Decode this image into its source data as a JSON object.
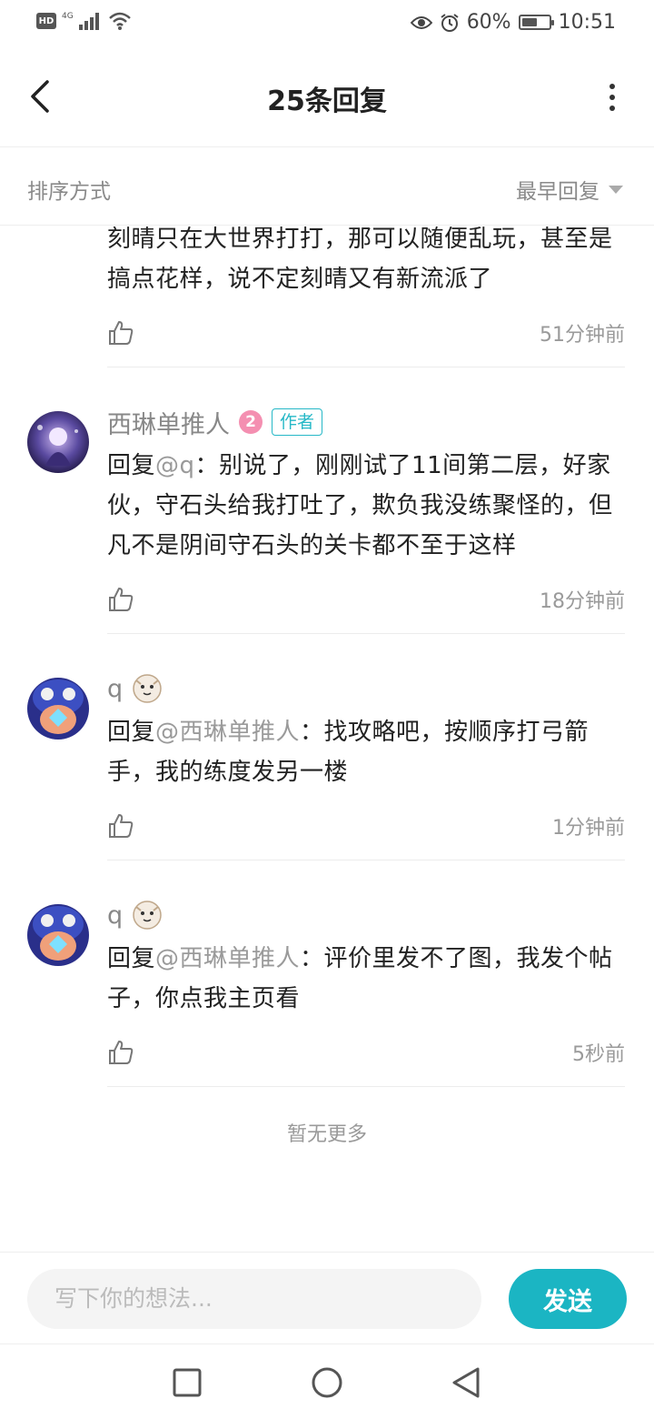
{
  "status_bar": {
    "hd": "HD",
    "network": "4G",
    "battery": "60%",
    "battery_level": 0.6,
    "time": "10:51"
  },
  "header": {
    "title": "25条回复"
  },
  "sort": {
    "label": "排序方式",
    "value": "最早回复"
  },
  "comments": [
    {
      "partial": true,
      "text": "刻晴只在大世界打打，那可以随便乱玩，甚至是搞点花样，说不定刻晴又有新流派了",
      "time": "51分钟前"
    },
    {
      "user": "西琳单推人",
      "level": "2",
      "tag": "作者",
      "reply_prefix": "回复",
      "mention": "@q",
      "text": "：别说了，刚刚试了11间第二层，好家伙，守石头给我打吐了，欺负我没练聚怪的，但凡不是阴间守石头的关卡都不至于这样",
      "time": "18分钟前"
    },
    {
      "user": "q",
      "reply_prefix": "回复",
      "mention": "@西琳单推人",
      "text": "：找攻略吧，按顺序打弓箭手，我的练度发另一楼",
      "time": "1分钟前"
    },
    {
      "user": "q",
      "reply_prefix": "回复",
      "mention": "@西琳单推人",
      "text": "：评价里发不了图，我发个帖子，你点我主页看",
      "time": "5秒前"
    }
  ],
  "footer_note": "暂无更多",
  "input": {
    "placeholder": "写下你的想法..."
  },
  "send_label": "发送",
  "colors": {
    "accent": "#1bb5c3",
    "secondary_text": "#8a8a8a",
    "level_badge": "#f48fb1"
  }
}
